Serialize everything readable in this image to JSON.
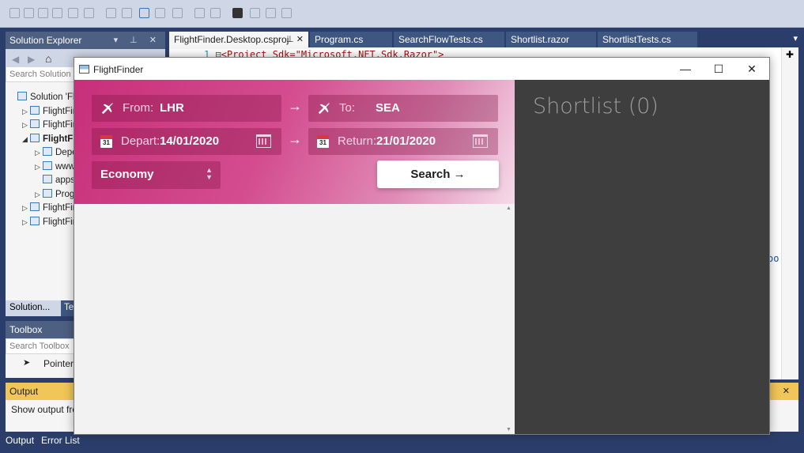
{
  "vs": {
    "solution_explorer": {
      "title": "Solution Explorer",
      "search_placeholder": "Search Solution",
      "tree": [
        {
          "label": "Solution 'Fl",
          "indent": 0,
          "arrow": ""
        },
        {
          "label": "FlightFir",
          "indent": 1,
          "arrow": "▷"
        },
        {
          "label": "FlightFir",
          "indent": 1,
          "arrow": "▷"
        },
        {
          "label": "FlightFi",
          "indent": 1,
          "arrow": "◢",
          "bold": true
        },
        {
          "label": "Depe",
          "indent": 2,
          "arrow": "▷"
        },
        {
          "label": "www",
          "indent": 2,
          "arrow": "▷"
        },
        {
          "label": "apps",
          "indent": 2,
          "arrow": ""
        },
        {
          "label": "Prog",
          "indent": 2,
          "arrow": "▷"
        },
        {
          "label": "FlightFir",
          "indent": 1,
          "arrow": "▷"
        },
        {
          "label": "FlightFir",
          "indent": 1,
          "arrow": "▷"
        }
      ],
      "bottom_tabs": [
        "Solution...",
        "Tea"
      ]
    },
    "toolbox": {
      "title": "Toolbox",
      "search_placeholder": "Search Toolbox",
      "item": "Pointer"
    },
    "output": {
      "title": "Output",
      "line": "Show output fro"
    },
    "bottom_tabs": [
      "Output",
      "Error List"
    ],
    "doc_tabs": [
      {
        "label": "FlightFinder.Desktop.csproj",
        "active": true
      },
      {
        "label": "Program.cs",
        "active": false
      },
      {
        "label": "SearchFlowTests.cs",
        "active": false
      },
      {
        "label": "Shortlist.razor",
        "active": false
      },
      {
        "label": "ShortlistTests.cs",
        "active": false
      }
    ],
    "code": {
      "line_number": "1",
      "text": "<Project Sdk=\"Microsoft.NET.Sdk.Razor\">"
    },
    "right_fragment": "oo"
  },
  "app": {
    "title": "FlightFinder",
    "from_label": "From:",
    "from_value": "LHR",
    "to_label": "To:",
    "to_value": "SEA",
    "depart_label": "Depart:",
    "depart_value": "14/01/2020",
    "return_label": "Return:",
    "return_value": "21/01/2020",
    "calendar_day": "31",
    "arrow": "→",
    "cabin_class": "Economy",
    "search_label": "Search →",
    "shortlist_title": "Shortlist (0)",
    "minimize": "—",
    "maximize": "☐",
    "close": "✕"
  }
}
